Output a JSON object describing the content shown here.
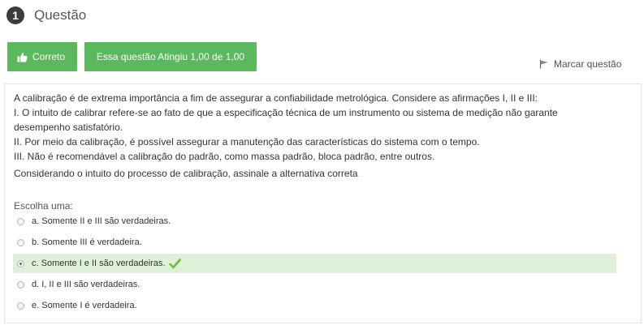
{
  "header": {
    "number": "1",
    "title": "Questão"
  },
  "status": {
    "correct_label": "Correto",
    "grade_label": "Essa questão Atingiu 1,00 de 1,00"
  },
  "flag": {
    "label": "Marcar questão"
  },
  "question": {
    "lines": [
      "A calibração é de extrema importância a fim de assegurar a confiabilidade metrológica. Considere as afirmações I, II e III:",
      "I. O intuito de calibrar refere-se ao fato de que a especificação técnica de um instrumento ou sistema de medição não garante",
      "desempenho satisfatório.",
      "II. Por meio da calibração, é possível assegurar a manutenção das características do sistema com o tempo.",
      "III. Não é recomendável a calibração do padrão, como massa padrão, bloca padrão, entre outros."
    ],
    "prompt": "Considerando o intuito do processo de calibração, assinale a alternativa correta",
    "choose_label": "Escolha uma:"
  },
  "answers": [
    {
      "label": "a. Somente II e III são verdadeiras.",
      "selected": false
    },
    {
      "label": "b. Somente III é verdadeira.",
      "selected": false
    },
    {
      "label": "c. Somente I e II são verdadeiras.",
      "selected": true
    },
    {
      "label": "d. I, II e III são verdadeiras.",
      "selected": false
    },
    {
      "label": "e. Somente I é verdadeira.",
      "selected": false
    }
  ],
  "colors": {
    "success": "#5cb85c",
    "selected_bg": "#dff0d8",
    "check": "#6cbf3a"
  },
  "icons": {
    "number": "number-circle-icon",
    "correct": "thumbs-up-icon",
    "flag": "flag-icon",
    "radio": "radio-icon",
    "correct_answer": "check-icon"
  }
}
